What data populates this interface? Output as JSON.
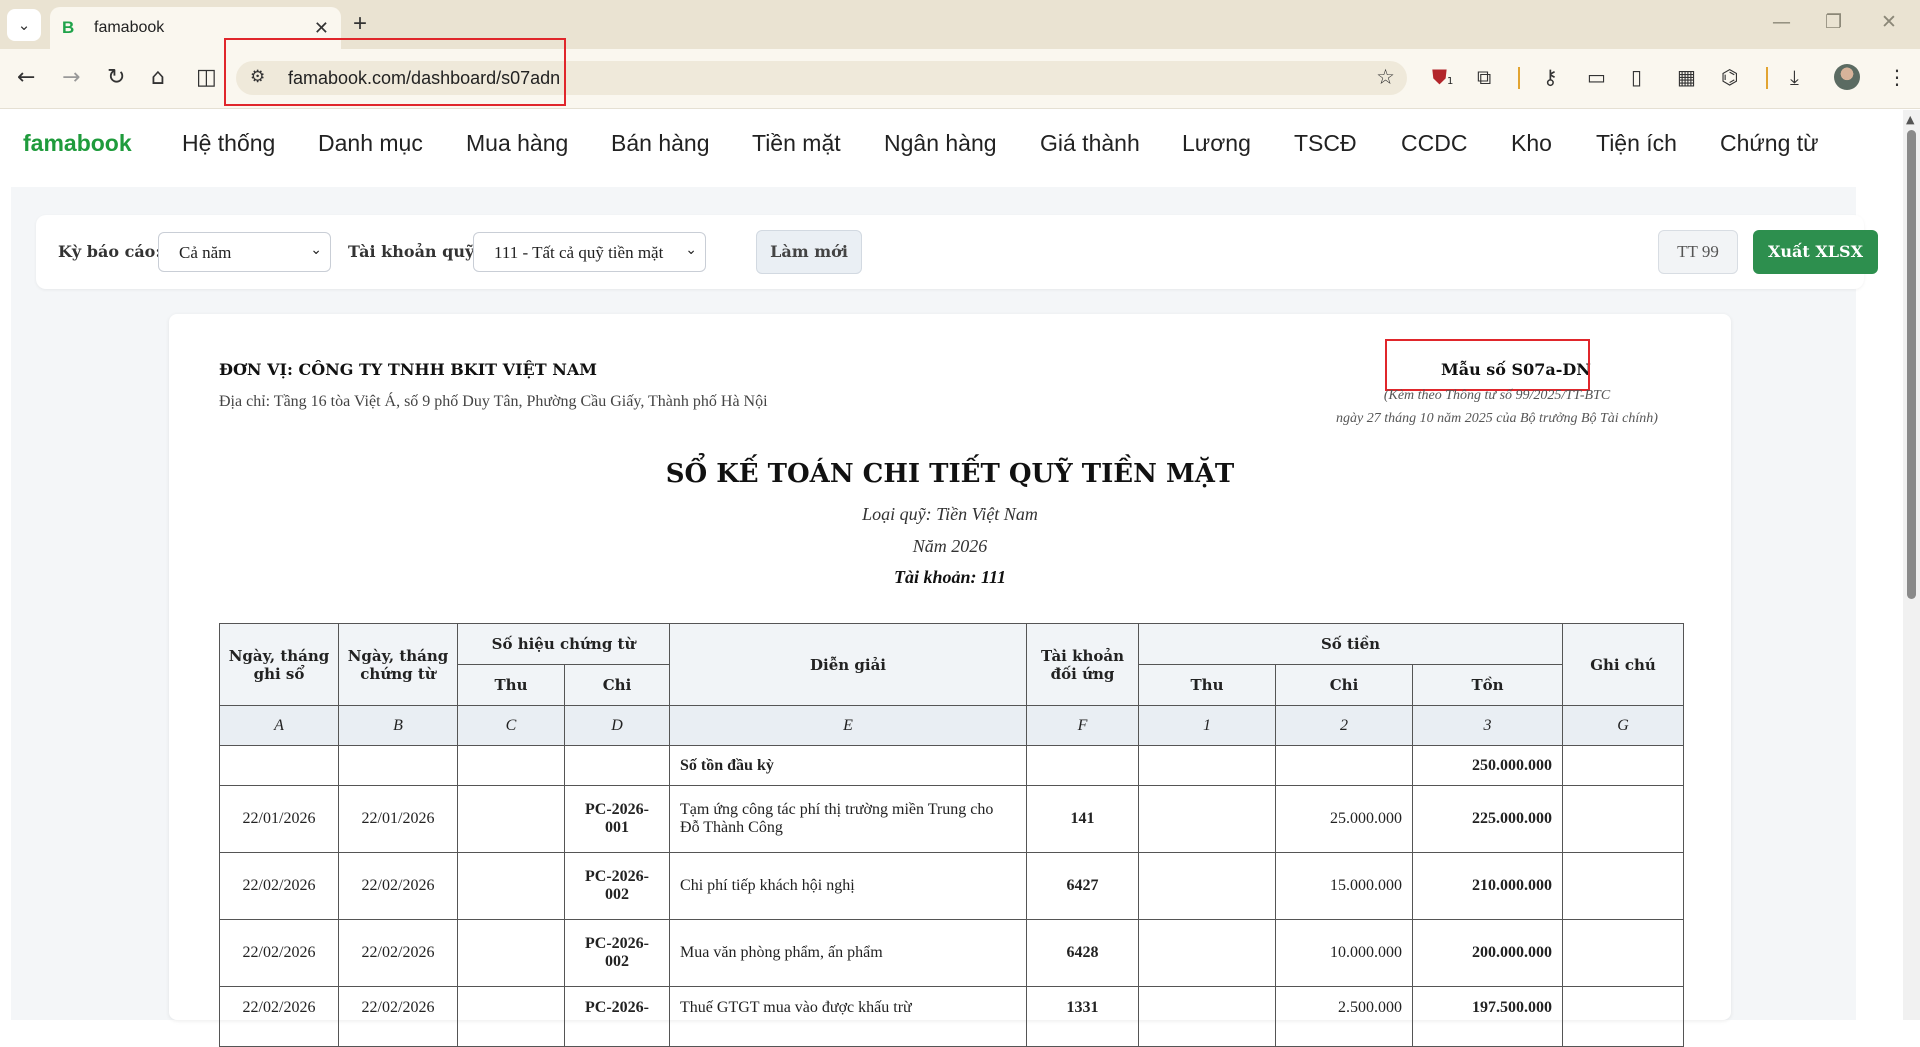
{
  "browser": {
    "tab_title": "famabook",
    "tab_favicon": "B",
    "url": "famabook.com/dashboard/s07adn",
    "icons": [
      "tab-search-icon",
      "close-icon",
      "plus-icon",
      "minimize-icon",
      "restore-icon",
      "close-window-icon",
      "back-icon",
      "forward-icon",
      "reload-icon",
      "home-icon",
      "split-view-icon",
      "site-settings-icon",
      "bookmark-star-icon",
      "extension-shield-icon",
      "puzzle-icon",
      "key-icon",
      "card-icon",
      "reading-list-icon",
      "tab-groups-icon",
      "incognito-icon",
      "download-icon",
      "more-icon"
    ],
    "extension_badge": "1"
  },
  "app": {
    "brand": "famabook",
    "menu": [
      "Hệ thống",
      "Danh mục",
      "Mua hàng",
      "Bán hàng",
      "Tiền mặt",
      "Ngân hàng",
      "Giá thành",
      "Lương",
      "TSCĐ",
      "CCDC",
      "Kho",
      "Tiện ích",
      "Chứng từ"
    ]
  },
  "filters": {
    "period_label": "Kỳ báo cáo:",
    "period_value": "Cả năm",
    "account_label": "Tài khoản quỹ:",
    "account_value": "111 - Tất cả quỹ tiền mặt",
    "refresh_label": "Làm mới",
    "circular_label": "TT 99",
    "export_label": "Xuất XLSX"
  },
  "document": {
    "unit": "ĐƠN VỊ: CÔNG TY TNHH BKIT VIỆT NAM",
    "address": "Địa chỉ: Tầng 16 tòa Việt Á, số 9 phố Duy Tân, Phường Cầu Giấy, Thành phố Hà Nội",
    "form_code": "Mẫu số S07a-DN",
    "form_note_1": "(Kèm theo Thông tư số 99/2025/TT-BTC",
    "form_note_2": "ngày 27 tháng 10 năm 2025 của Bộ trưởng Bộ Tài chính)",
    "title": "SỔ KẾ TOÁN CHI TIẾT QUỸ TIỀN MẶT",
    "fund_type": "Loại quỹ: Tiền Việt Nam",
    "year": "Năm 2026",
    "account": "Tài khoản: 111"
  },
  "table": {
    "headers": {
      "record_date": "Ngày, tháng ghi sổ",
      "doc_date": "Ngày, tháng chứng từ",
      "doc_no": "Số hiệu chứng từ",
      "doc_no_in": "Thu",
      "doc_no_out": "Chi",
      "description": "Diễn giải",
      "contra": "Tài khoản đối ứng",
      "amount": "Số tiền",
      "amount_in": "Thu",
      "amount_out": "Chi",
      "balance": "Tồn",
      "note": "Ghi chú"
    },
    "letters": [
      "A",
      "B",
      "C",
      "D",
      "E",
      "F",
      "1",
      "2",
      "3",
      "G"
    ],
    "opening_label": "Số tồn đầu kỳ",
    "opening_balance": "250.000.000",
    "rows": [
      {
        "record_date": "22/01/2026",
        "doc_date": "22/01/2026",
        "no_in": "",
        "no_out": "PC-2026-001",
        "description": "Tạm ứng công tác phí thị trường miền Trung cho Đỗ Thành Công",
        "contra": "141",
        "amt_in": "",
        "amt_out": "25.000.000",
        "balance": "225.000.000",
        "note": ""
      },
      {
        "record_date": "22/02/2026",
        "doc_date": "22/02/2026",
        "no_in": "",
        "no_out": "PC-2026-002",
        "description": "Chi phí tiếp khách hội nghị",
        "contra": "6427",
        "amt_in": "",
        "amt_out": "15.000.000",
        "balance": "210.000.000",
        "note": ""
      },
      {
        "record_date": "22/02/2026",
        "doc_date": "22/02/2026",
        "no_in": "",
        "no_out": "PC-2026-002",
        "description": "Mua văn phòng phẩm, ấn phẩm",
        "contra": "6428",
        "amt_in": "",
        "amt_out": "10.000.000",
        "balance": "200.000.000",
        "note": ""
      },
      {
        "record_date": "22/02/2026",
        "doc_date": "22/02/2026",
        "no_in": "",
        "no_out": "PC-2026-",
        "description": "Thuế GTGT mua vào được khấu trừ",
        "contra": "1331",
        "amt_in": "",
        "amt_out": "2.500.000",
        "balance": "197.500.000",
        "note": ""
      }
    ]
  }
}
